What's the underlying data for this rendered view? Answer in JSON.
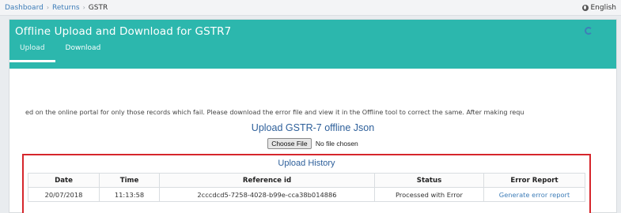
{
  "breadcrumb": {
    "items": [
      "Dashboard",
      "Returns"
    ],
    "current": "GSTR"
  },
  "language": {
    "label": "English",
    "icon": "globe-icon"
  },
  "header": {
    "title": "Offline Upload and Download for GSTR7",
    "refresh_icon": "refresh-icon",
    "tabs": [
      {
        "label": "Upload",
        "active": true
      },
      {
        "label": "Download",
        "active": false
      }
    ]
  },
  "notice": {
    "text": "ed on the online portal for only those records which fail. Please download the error file and view it in the Offline tool to correct the same. After making requ"
  },
  "upload": {
    "title": "Upload GSTR-7 offline Json",
    "choose_file_label": "Choose File",
    "no_file_text": "No file chosen"
  },
  "history": {
    "title": "Upload History",
    "columns": [
      "Date",
      "Time",
      "Reference id",
      "Status",
      "Error Report"
    ],
    "rows": [
      {
        "date": "20/07/2018",
        "time": "11:13:58",
        "reference_id": "2cccdcd5-7258-4028-b99e-cca38b014886",
        "status": "Processed with Error",
        "error_report": "Generate error report"
      }
    ]
  },
  "colors": {
    "header_bg": "#2cb7ad",
    "link": "#3e7db8",
    "highlight_border": "#d6262c"
  }
}
